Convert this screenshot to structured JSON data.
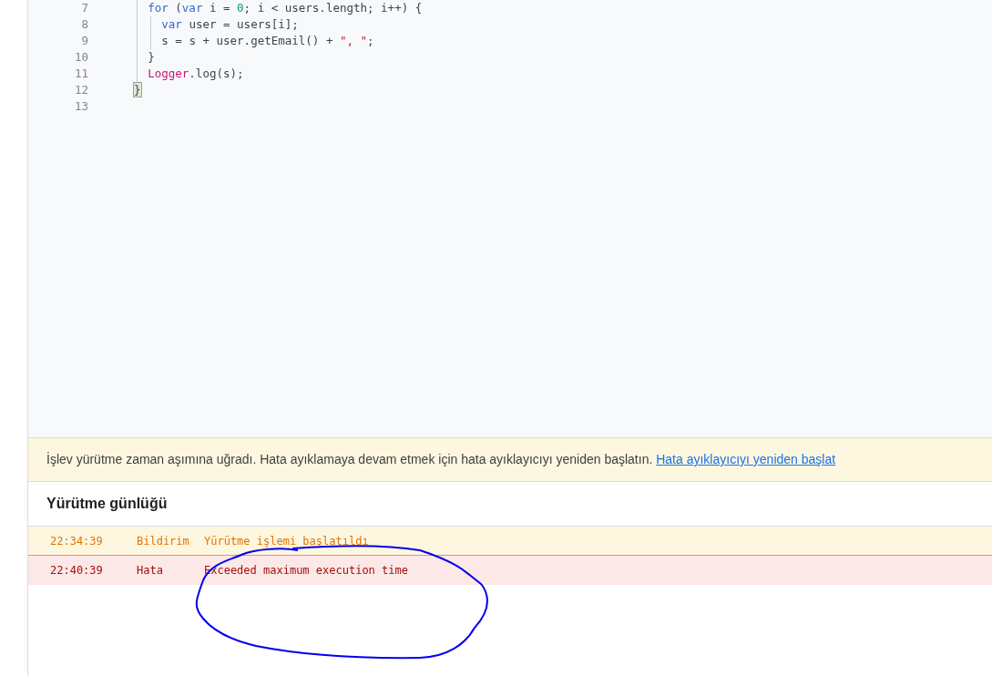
{
  "editor": {
    "lines": [
      {
        "children": [
          {
            "number": "7",
            "tokens": [
              {
                "kind": "keyword",
                "text": "for"
              },
              {
                "kind": "plain",
                "text": " ("
              },
              {
                "kind": "keyword",
                "text": "var"
              },
              {
                "kind": "plain",
                "text": " i = "
              },
              {
                "kind": "number",
                "text": "0"
              },
              {
                "kind": "plain",
                "text": "; i < users.length; i++) {"
              }
            ],
            "children": [
              {
                "number": "8",
                "tokens": [
                  {
                    "kind": "keyword",
                    "text": "var"
                  },
                  {
                    "kind": "plain",
                    "text": " user = users[i];"
                  }
                ]
              },
              {
                "number": "9",
                "tokens": [
                  {
                    "kind": "plain",
                    "text": "s = s + user.getEmail() + "
                  },
                  {
                    "kind": "string",
                    "text": "\", \""
                  },
                  {
                    "kind": "plain",
                    "text": ";"
                  }
                ]
              }
            ]
          },
          {
            "number": "10",
            "tokens": [
              {
                "kind": "plain",
                "text": "}"
              }
            ]
          },
          {
            "number": "11",
            "tokens": [
              {
                "kind": "builtin",
                "text": "Logger"
              },
              {
                "kind": "plain",
                "text": ".log(s);"
              }
            ]
          }
        ]
      },
      {
        "number": "12",
        "tokens": [
          {
            "kind": "bracket-match",
            "text": "}"
          }
        ]
      },
      {
        "number": "13"
      }
    ]
  },
  "banner": {
    "message": "İşlev yürütme zaman aşımına uğradı. Hata ayıklamaya devam etmek için hata ayıklayıcıyı yeniden başlatın.",
    "link": "Hata ayıklayıcıyı yeniden başlat"
  },
  "log": {
    "title": "Yürütme günlüğü",
    "rows": [
      {
        "kind": "info",
        "time": "22:34:39",
        "level": "Bildirim",
        "message": "Yürütme işlemi başlatıldı"
      },
      {
        "kind": "error",
        "time": "22:40:39",
        "level": "Hata",
        "message": "Exceeded maximum execution time"
      }
    ]
  }
}
